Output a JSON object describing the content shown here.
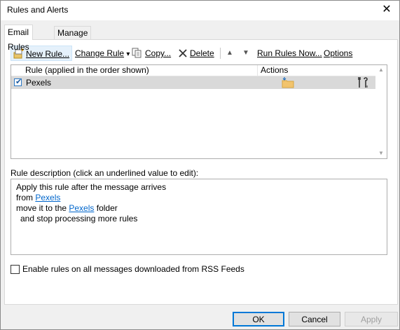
{
  "window": {
    "title": "Rules and Alerts",
    "close_glyph": "✕"
  },
  "tabs": [
    {
      "label": "Email Rules",
      "active": true
    },
    {
      "label": "Manage Alerts",
      "active": false
    }
  ],
  "toolbar": {
    "new_rule": "New Rule...",
    "change_rule": "Change Rule",
    "change_rule_arrow": "▾",
    "copy": "Copy...",
    "delete": "Delete",
    "move_up": "▲",
    "move_down": "▼",
    "run_rules_now": "Run Rules Now...",
    "options": "Options"
  },
  "rules_list": {
    "columns": [
      "Rule (applied in the order shown)",
      "Actions"
    ],
    "rows": [
      {
        "name": "Pexels",
        "checked": true,
        "check_glyph": "✔",
        "actions": [
          "folder-move-icon",
          "tools-icon"
        ]
      }
    ],
    "scroll_up": "▲",
    "scroll_down": "▼"
  },
  "description": {
    "label": "Rule description (click an underlined value to edit):",
    "line1": "Apply this rule after the message arrives",
    "line2_prefix": "from ",
    "line2_link": "Pexels",
    "line3_prefix": "move it to the ",
    "line3_link": "Pexels",
    "line3_suffix": " folder",
    "line4": "and stop processing more rules"
  },
  "rss": {
    "label": "Enable rules on all messages downloaded from RSS Feeds",
    "checked": false
  },
  "buttons": {
    "ok": "OK",
    "cancel": "Cancel",
    "apply": "Apply"
  },
  "colors": {
    "link": "#0066cc",
    "accent": "#0078d7",
    "selected_row": "#d9d9d9"
  }
}
